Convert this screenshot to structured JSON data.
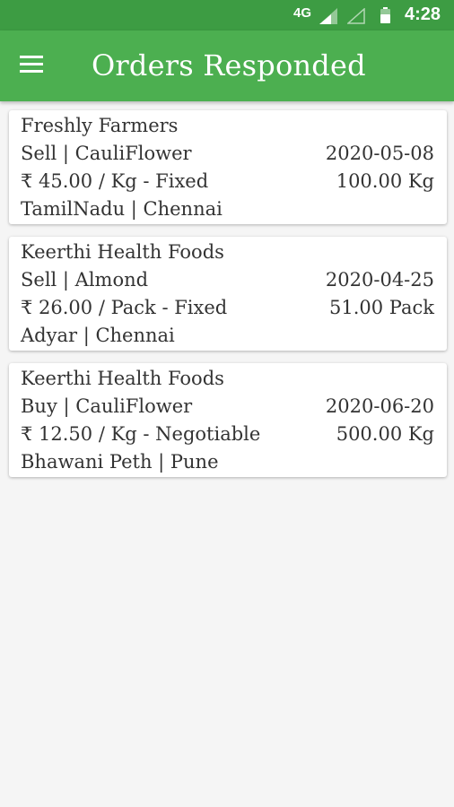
{
  "status_bar": {
    "network": "4G",
    "time": "4:28"
  },
  "app_bar": {
    "title": "Orders Responded",
    "menu_icon": "hamburger-menu-icon"
  },
  "orders": [
    {
      "company": "Freshly Farmers",
      "type_product": "Sell | CauliFlower",
      "date": "2020-05-08",
      "price": "₹ 45.00 / Kg  - Fixed",
      "quantity": "100.00 Kg",
      "location": "TamilNadu | Chennai"
    },
    {
      "company": "Keerthi Health Foods",
      "type_product": "Sell | Almond",
      "date": "2020-04-25",
      "price": "₹ 26.00 / Pack  - Fixed",
      "quantity": "51.00 Pack",
      "location": "Adyar | Chennai"
    },
    {
      "company": "Keerthi Health Foods",
      "type_product": "Buy | CauliFlower",
      "date": "2020-06-20",
      "price": "₹ 12.50 / Kg - Negotiable",
      "quantity": "500.00 Kg",
      "location": "Bhawani Peth | Pune"
    }
  ],
  "colors": {
    "status_bar": "#3d9c43",
    "app_bar": "#4caf50",
    "background": "#f5f5f5"
  }
}
